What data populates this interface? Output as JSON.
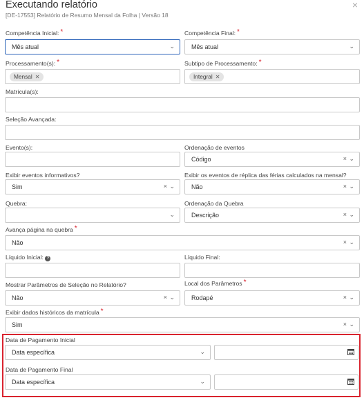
{
  "header": {
    "title": "Executando relatório",
    "subtitle": "[DE-17553] Relatório de Resumo Mensal da Folha | Versão 18",
    "close_glyph": "×"
  },
  "fields": {
    "competencia_inicial": {
      "label": "Competência Inicial:",
      "required": "*",
      "value": "Mês atual"
    },
    "competencia_final": {
      "label": "Competência Final:",
      "required": "*",
      "value": "Mês atual"
    },
    "processamentos": {
      "label": "Processamento(s):",
      "required": "*",
      "chip": "Mensal"
    },
    "subtipo": {
      "label": "Subtipo de Processamento:",
      "required": "*",
      "chip": "Integral"
    },
    "matriculas": {
      "label": "Matrícula(s):",
      "value": ""
    },
    "selecao_avancada": {
      "label": "Seleção Avançada:",
      "value": ""
    },
    "eventos": {
      "label": "Evento(s):",
      "value": ""
    },
    "ordenacao_eventos": {
      "label": "Ordenação de eventos",
      "value": "Código"
    },
    "exibir_informativos": {
      "label": "Exibir eventos informativos?",
      "value": "Sim"
    },
    "exibir_replica": {
      "label": "Exibir os eventos de réplica das férias calculados na mensal?",
      "value": "Não"
    },
    "quebra": {
      "label": "Quebra:",
      "value": ""
    },
    "ordenacao_quebra": {
      "label": "Ordenação da Quebra",
      "value": "Descrição"
    },
    "avanca_pagina": {
      "label": "Avança página na quebra",
      "required": "*",
      "value": "Não"
    },
    "liquido_inicial": {
      "label": "Líquido Inicial:",
      "value": ""
    },
    "liquido_final": {
      "label": "Líquido Final:",
      "value": ""
    },
    "mostrar_parametros": {
      "label": "Mostrar Parâmetros de Seleção no Relatório?",
      "value": "Não"
    },
    "local_parametros": {
      "label": "Local dos Parâmetros",
      "required": "*",
      "value": "Rodapé"
    },
    "exibir_historicos": {
      "label": "Exibir dados históricos da matrícula",
      "required": "*",
      "value": "Sim"
    },
    "data_pagamento_inicial": {
      "label": "Data de Pagamento Inicial",
      "value": "Data específica",
      "date": ""
    },
    "data_pagamento_final": {
      "label": "Data de Pagamento Final",
      "value": "Data específica",
      "date": ""
    }
  },
  "icons": {
    "chevron": "chevron-down-icon",
    "clear": "clear-icon",
    "calendar": "calendar-icon",
    "info": "info-icon"
  },
  "colors": {
    "required": "#d9232e",
    "focus_border": "#2a62b8",
    "highlight": "#d9232e"
  }
}
